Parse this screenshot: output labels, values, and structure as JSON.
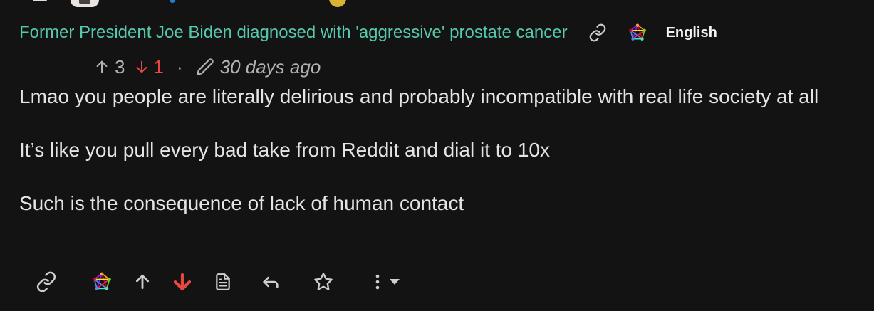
{
  "post": {
    "title": "Former President Joe Biden diagnosed with 'aggressive' prostate cancer",
    "language": "English"
  },
  "comment": {
    "upvotes": "3",
    "downvotes": "1",
    "separator": "·",
    "time_ago": "30 days ago",
    "paragraphs": [
      "Lmao you people are literally delirious and probably incompatible with real life society at all",
      "It’s like you pull every bad take from Reddit and dial it to 10x",
      "Such is the consequence of lack of human contact"
    ]
  },
  "colors": {
    "background": "#131313",
    "title_link": "#56c8ab",
    "downvote": "#e8483f",
    "muted_text": "#b3b3b3"
  },
  "icons": {
    "title_row": [
      "link-icon",
      "fediverse-icon"
    ],
    "meta_row": [
      "arrow-up-icon",
      "arrow-down-icon",
      "pencil-icon"
    ],
    "action_bar": [
      "link-icon",
      "fediverse-icon",
      "upvote-icon",
      "downvote-icon",
      "view-source-icon",
      "reply-icon",
      "star-icon",
      "more-options-icon",
      "caret-down-icon"
    ]
  }
}
